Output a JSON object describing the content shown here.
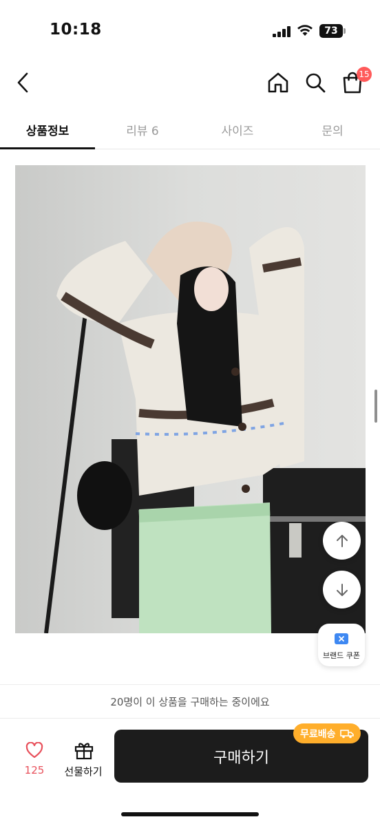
{
  "status_bar": {
    "time": "10:18",
    "battery": "73"
  },
  "nav": {
    "back_icon": "chevron-left-icon",
    "home_icon": "home-icon",
    "search_icon": "search-icon",
    "cart_icon": "shopping-bag-icon",
    "cart_count": "15"
  },
  "tabs": [
    {
      "label": "상품정보",
      "active": true
    },
    {
      "label": "리뷰 6",
      "active": false
    },
    {
      "label": "사이즈",
      "active": false
    },
    {
      "label": "문의",
      "active": false
    }
  ],
  "product_image": {
    "icon": "product-photo"
  },
  "floating": {
    "up_icon": "arrow-up-icon",
    "down_icon": "arrow-down-icon",
    "coupon_label": "브랜드 쿠폰"
  },
  "purchase_notice": "20명이 이 상품을 구매하는 중이에요",
  "bottom_bar": {
    "wish_count": "125",
    "gift_label": "선물하기",
    "buy_label": "구매하기",
    "free_shipping_label": "무료배송"
  },
  "colors": {
    "accent_badge": "#ff5a5a",
    "wish_heart": "#e8505b",
    "free_ship": "#ffae2b",
    "buy_button": "#1c1c1c",
    "coupon_blue": "#3e88f2"
  }
}
